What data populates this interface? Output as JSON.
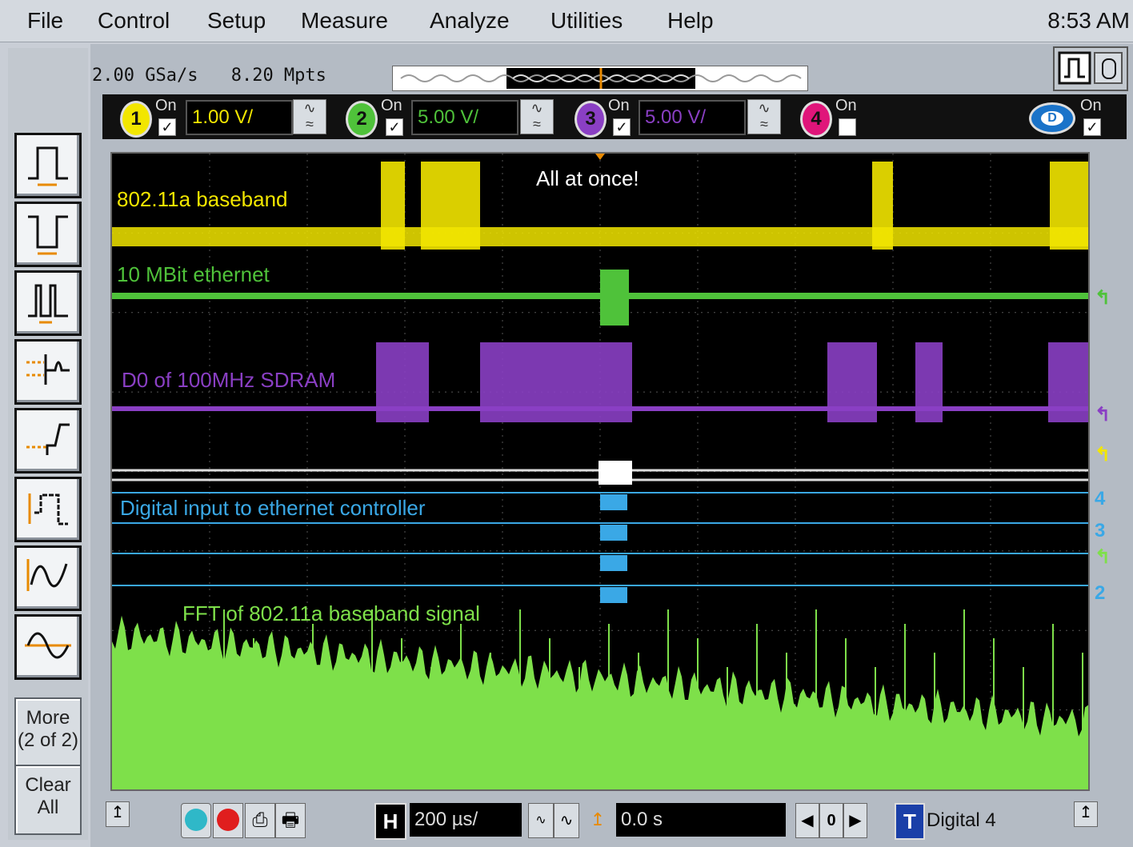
{
  "menu": {
    "items": [
      {
        "label": "File"
      },
      {
        "label": "Control"
      },
      {
        "label": "Setup"
      },
      {
        "label": "Measure"
      },
      {
        "label": "Analyze"
      },
      {
        "label": "Utilities"
      },
      {
        "label": "Help"
      }
    ],
    "clock": "8:53 AM"
  },
  "acquisition": {
    "sample_rate": "2.00 GSa/s",
    "memory_depth": "8.20 Mpts"
  },
  "channels": [
    {
      "number": "1",
      "on_label": "On",
      "checked": true,
      "scale": "1.00 V/",
      "color": "#f2e600"
    },
    {
      "number": "2",
      "on_label": "On",
      "checked": true,
      "scale": "5.00 V/",
      "color": "#4fc23a"
    },
    {
      "number": "3",
      "on_label": "On",
      "checked": true,
      "scale": "5.00 V/",
      "color": "#8a3fc4"
    },
    {
      "number": "4",
      "on_label": "On",
      "checked": false,
      "color": "#e0157a"
    }
  ],
  "digital_channel": {
    "on_label": "On",
    "checked": true
  },
  "sidebar": {
    "icons": [
      "pulse-width-positive-icon",
      "pulse-width-negative-icon",
      "glitch-icon",
      "edge-then-edge-icon",
      "rise-time-icon",
      "pattern-icon",
      "sine-wave-icon",
      "waveform-icon"
    ],
    "more_label": "More\n(2 of 2)",
    "clear_all_label": "Clear\nAll"
  },
  "screen": {
    "annotation": "All at once!",
    "labels": {
      "ch1": "802.11a baseband",
      "ch2": "10 MBit ethernet",
      "ch3": "D0 of 100MHz SDRAM",
      "digital": "Digital input to ethernet controller",
      "fft": "FFT of 802.11a baseband signal"
    },
    "right_markers": [
      "4",
      "3",
      "2"
    ],
    "colors": {
      "ch1": "#f2e600",
      "ch2": "#4fc23a",
      "ch3": "#8a3fc4",
      "digital": "#3aa8e6",
      "fft": "#7ee04a",
      "grid": "#555555"
    }
  },
  "bottom": {
    "horizontal_label": "H",
    "timebase": "200 µs/",
    "delay": "0.0 s",
    "trigger_label": "T",
    "trigger_source": "Digital 4",
    "delay_zero": "0"
  }
}
